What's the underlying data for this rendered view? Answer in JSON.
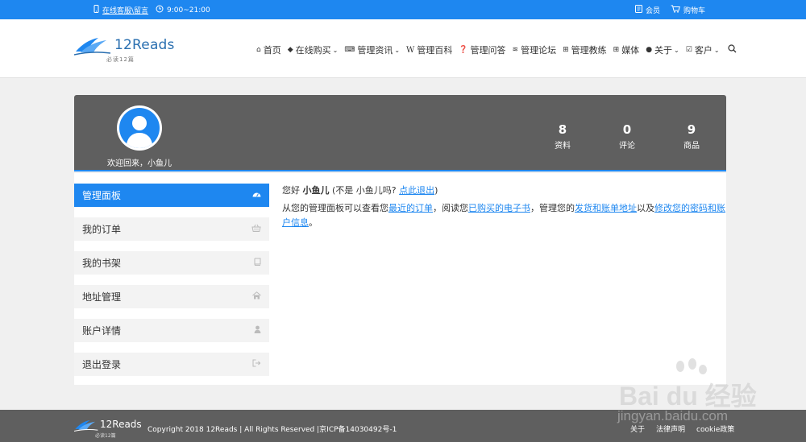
{
  "topbar": {
    "service_link": "在线客服\\留言",
    "hours": "9:00~21:00",
    "member": "会员",
    "cart": "购物车"
  },
  "logo": {
    "name": "12Reads",
    "sub": "必读12篇"
  },
  "nav": {
    "items": [
      {
        "label": "首页",
        "icon": "home-icon"
      },
      {
        "label": "在线购买",
        "icon": "tag-icon",
        "dropdown": true
      },
      {
        "label": "管理资讯",
        "icon": "keyboard-icon",
        "dropdown": true
      },
      {
        "label": "管理百科",
        "icon": "wikipedia-icon"
      },
      {
        "label": "管理问答",
        "icon": "question-icon"
      },
      {
        "label": "管理论坛",
        "icon": "forum-icon"
      },
      {
        "label": "管理教练",
        "icon": "plus-square-icon"
      },
      {
        "label": "媒体",
        "icon": "windows-icon"
      },
      {
        "label": "关于",
        "icon": "user-icon",
        "dropdown": true
      },
      {
        "label": "客户",
        "icon": "check-square-icon",
        "dropdown": true
      }
    ]
  },
  "profile": {
    "welcome": "欢迎回来，小鱼儿",
    "stats": [
      {
        "value": "8",
        "label": "资料"
      },
      {
        "value": "0",
        "label": "评论"
      },
      {
        "value": "9",
        "label": "商品"
      }
    ]
  },
  "sidebar": {
    "items": [
      {
        "label": "管理面板",
        "icon": "dashboard-icon",
        "active": true
      },
      {
        "label": "我的订单",
        "icon": "basket-icon"
      },
      {
        "label": "我的书架",
        "icon": "book-icon"
      },
      {
        "label": "地址管理",
        "icon": "home-icon"
      },
      {
        "label": "账户详情",
        "icon": "user-icon"
      },
      {
        "label": "退出登录",
        "icon": "sign-out-icon"
      }
    ]
  },
  "content": {
    "hello_prefix": "您好",
    "username": "小鱼儿",
    "not_you_prefix": "(不是 小鱼儿吗? ",
    "logout_link": "点此退出",
    "not_you_suffix": ")",
    "desc_1": "从您的管理面板可以查看您",
    "link_orders": "最近的订单",
    "desc_2": "，阅读您",
    "link_ebooks": "已购买的电子书",
    "desc_3": "，管理您的",
    "link_address": "发货和账单地址",
    "desc_4": "以及",
    "link_account": "修改您的密码和账户信息",
    "desc_5": "。"
  },
  "footer": {
    "logo_name": "12Reads",
    "logo_sub": "必读12篇",
    "copyright": "Copyright 2018 12Reads | All Rights Reserved |京ICP备14030492号-1",
    "links": [
      "关于",
      "法律声明",
      "cookie政策"
    ]
  },
  "watermark": {
    "text": "Bai du 经验",
    "sub": "jingyan.baidu.com"
  },
  "colors": {
    "accent": "#1e87f0",
    "banner": "#5f5f5f",
    "footer": "#5f5f5f"
  }
}
